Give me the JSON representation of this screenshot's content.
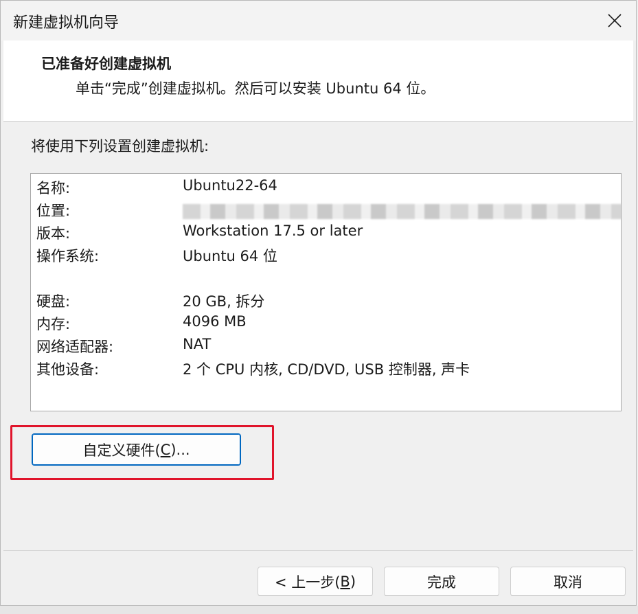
{
  "window": {
    "title": "新建虚拟机向导"
  },
  "header": {
    "title": "已准备好创建虚拟机",
    "subtitle": "单击“完成”创建虚拟机。然后可以安装 Ubuntu 64 位。"
  },
  "intro": "将使用下列设置创建虚拟机:",
  "summary": {
    "name_key": "名称:",
    "name_val": "Ubuntu22-64",
    "location_key": "位置:",
    "version_key": "版本:",
    "version_val": "Workstation 17.5 or later",
    "os_key": "操作系统:",
    "os_val": "Ubuntu 64 位",
    "disk_key": "硬盘:",
    "disk_val": "20 GB, 拆分",
    "memory_key": "内存:",
    "memory_val": "4096 MB",
    "network_key": "网络适配器:",
    "network_val": "NAT",
    "other_key": "其他设备:",
    "other_val": "2 个 CPU 内核, CD/DVD, USB 控制器, 声卡"
  },
  "buttons": {
    "customize_pre": "自定义硬件(",
    "customize_key": "C",
    "customize_post": ")...",
    "back_pre": "< 上一步(",
    "back_key": "B",
    "back_post": ")",
    "finish": "完成",
    "cancel": "取消"
  },
  "colors": {
    "highlight": "#e0142b",
    "focus": "#0067c0"
  },
  "icons": {
    "close": "close-icon"
  }
}
